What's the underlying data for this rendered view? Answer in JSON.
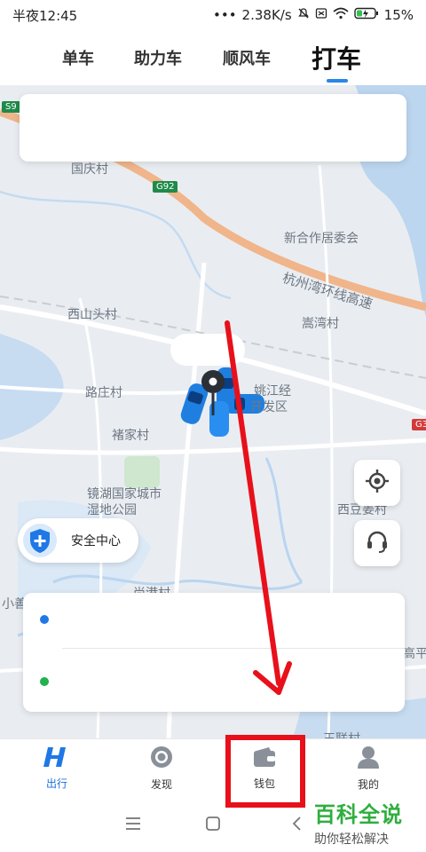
{
  "status_bar": {
    "time": "半夜12:45",
    "dots": "•••",
    "speed": "2.38K/s",
    "battery": "15%"
  },
  "tabs": [
    {
      "label": "单车"
    },
    {
      "label": "助力车"
    },
    {
      "label": "顺风车"
    },
    {
      "label": "打车",
      "active": true
    }
  ],
  "map": {
    "road_badges": [
      {
        "label": "S9"
      },
      {
        "label": "G92"
      },
      {
        "label": "G3"
      }
    ],
    "places": [
      "国庆村",
      "新合作居委会",
      "杭州湾环线高速",
      "西山头村",
      "嵩湾村",
      "路庄村",
      "褚家村",
      "镜湖国家城市湿地公园",
      "西豆姜村",
      "高平",
      "尚港村",
      "王联村",
      "小善",
      "姚江经",
      "开发区"
    ]
  },
  "search_card": {
    "text": ""
  },
  "controls": {
    "locate_icon": "locate-icon",
    "service_icon": "headset-icon"
  },
  "safety_center": {
    "label": "安全中心"
  },
  "route_card": {
    "start_text": "",
    "end_text": "",
    "start_color": "#1f78e6",
    "end_color": "#22b14c"
  },
  "bottom_nav": [
    {
      "label": "出行",
      "icon": "travel-logo-icon",
      "active": true
    },
    {
      "label": "发现",
      "icon": "discover-icon"
    },
    {
      "label": "钱包",
      "icon": "wallet-icon"
    },
    {
      "label": "我的",
      "icon": "profile-icon"
    }
  ],
  "system_nav": {
    "menu_icon": "menu-icon",
    "home_icon": "home-icon",
    "back_icon": "back-icon"
  },
  "watermark": {
    "title": "百科全说",
    "subtitle": "助你轻松解决"
  },
  "colors": {
    "accent": "#2a86e8",
    "annotation": "#e8101a",
    "highway": "#f0b58a"
  }
}
